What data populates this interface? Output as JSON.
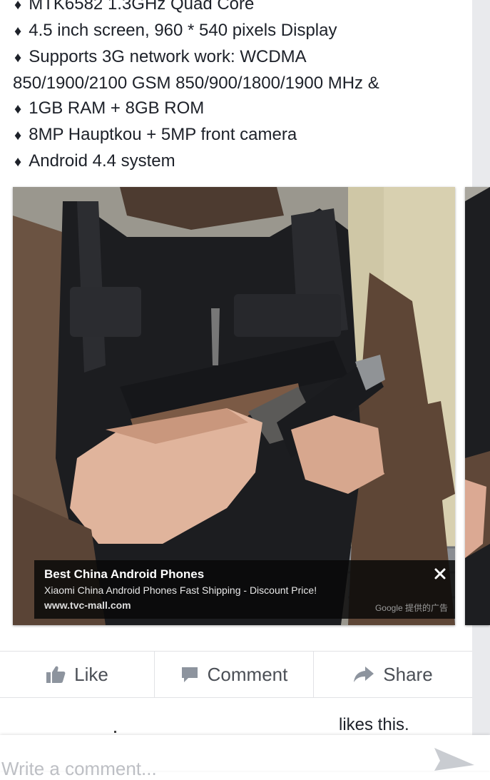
{
  "specs": [
    {
      "bullet": "♦",
      "text": "MTK6582 1.3GHz Quad Core"
    },
    {
      "bullet": "♦",
      "text": "4.5 inch screen, 960 * 540 pixels Display"
    },
    {
      "bullet": "♦",
      "text": "Supports 3G network work: WCDMA"
    },
    {
      "bullet": "",
      "text": "850/1900/2100 GSM 850/900/1800/1900 MHz &"
    },
    {
      "bullet": "♦",
      "text": "1GB RAM + 8GB ROM"
    },
    {
      "bullet": "♦",
      "text": "8MP Hauptkou + 5MP front camera"
    },
    {
      "bullet": "♦",
      "text": "Android 4.4 system"
    }
  ],
  "ad": {
    "title": "Best China Android Phones",
    "description": "Xiaomi China Android Phones Fast Shipping - Discount Price!",
    "url": "www.tvc-mall.com",
    "provider": "Google 提供的广告",
    "close_icon": "close-icon"
  },
  "actions": {
    "like_label": "Like",
    "comment_label": "Comment",
    "share_label": "Share"
  },
  "likes": {
    "text": "likes this."
  },
  "comment_box": {
    "placeholder": "Write a comment..."
  },
  "colors": {
    "text": "#1d2129",
    "action_text": "#4b4f56",
    "divider": "#e1e2e5",
    "side_strip": "#e9eaed",
    "ad_background": "#080808"
  }
}
